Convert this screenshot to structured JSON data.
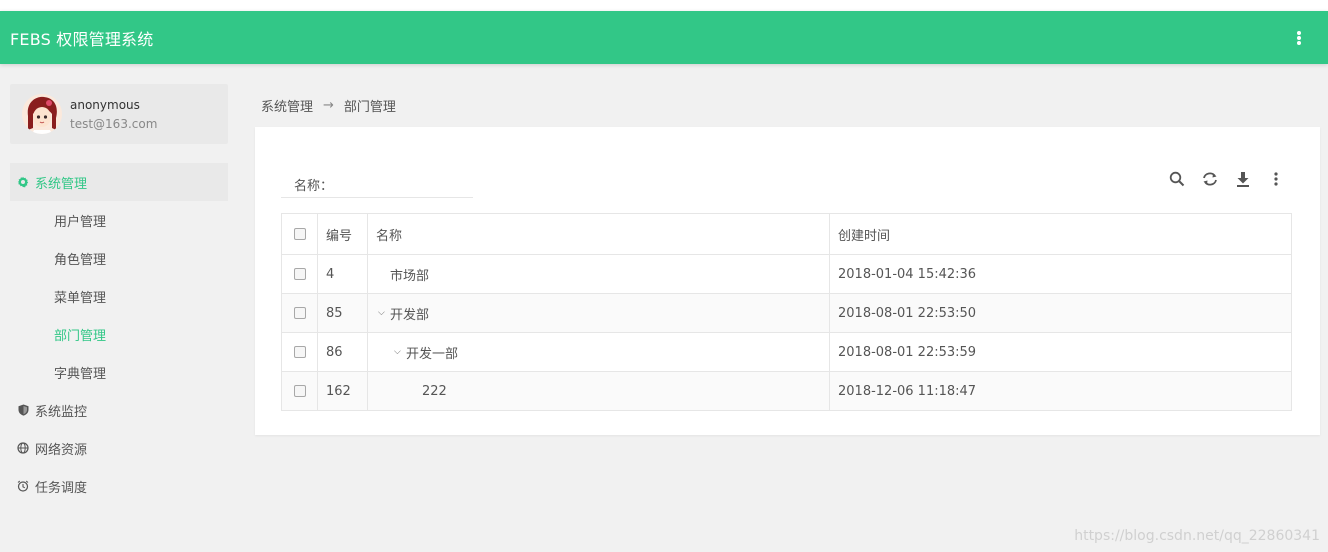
{
  "app": {
    "title": "FEBS 权限管理系统"
  },
  "user": {
    "name": "anonymous",
    "email": "test@163.com"
  },
  "nav": {
    "groups": [
      {
        "label": "系统管理",
        "icon": "gear-icon",
        "expanded": true,
        "children": [
          "用户管理",
          "角色管理",
          "菜单管理",
          "部门管理",
          "字典管理"
        ],
        "active_child": "部门管理"
      },
      {
        "label": "系统监控",
        "icon": "shield-icon"
      },
      {
        "label": "网络资源",
        "icon": "globe-icon"
      },
      {
        "label": "任务调度",
        "icon": "clock-icon"
      }
    ]
  },
  "breadcrumb": {
    "parent": "系统管理",
    "separator": "→",
    "current": "部门管理"
  },
  "filter": {
    "label": "名称：",
    "value": "",
    "placeholder": ""
  },
  "toolbar": [
    "search-icon",
    "refresh-icon",
    "download-icon",
    "more-vertical-icon"
  ],
  "table": {
    "columns": [
      "编号",
      "名称",
      "创建时间"
    ],
    "rows": [
      {
        "id": "4",
        "name": "市场部",
        "created": "2018-01-04 15:42:36",
        "level": 0,
        "expandable": false
      },
      {
        "id": "85",
        "name": "开发部",
        "created": "2018-08-01 22:53:50",
        "level": 0,
        "expandable": true
      },
      {
        "id": "86",
        "name": "开发一部",
        "created": "2018-08-01 22:53:59",
        "level": 1,
        "expandable": true
      },
      {
        "id": "162",
        "name": "222",
        "created": "2018-12-06 11:18:47",
        "level": 2,
        "expandable": false
      }
    ]
  },
  "colors": {
    "brand": "#32c787",
    "background": "#f1f1f1"
  },
  "watermark": "https://blog.csdn.net/qq_22860341"
}
